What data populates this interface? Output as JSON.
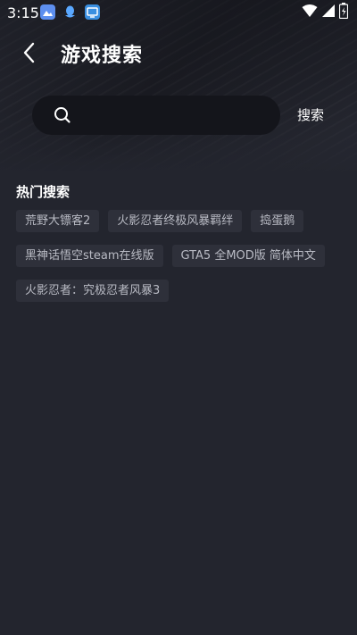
{
  "status_bar": {
    "time": "3:15",
    "icons": [
      "gallery-icon",
      "qq-icon",
      "tv-icon",
      "wifi-icon",
      "signal-icon",
      "battery-icon"
    ]
  },
  "header": {
    "title": "游戏搜索",
    "back_icon": "back-arrow-icon"
  },
  "search": {
    "placeholder": "",
    "value": "",
    "button_label": "搜索",
    "icon": "search-icon"
  },
  "hot": {
    "title": "热门搜索",
    "rows": [
      [
        "荒野大镖客2",
        "火影忍者终极风暴羁绊",
        "捣蛋鹅"
      ],
      [
        "黑神话悟空steam在线版",
        "GTA5 全MOD版 简体中文"
      ],
      [
        "火影忍者：究极忍者风暴3"
      ]
    ]
  },
  "colors": {
    "background": "#23252e",
    "search_box": "#14151b",
    "tag_background": "#2e303a",
    "tag_text": "#b9bbc4"
  }
}
